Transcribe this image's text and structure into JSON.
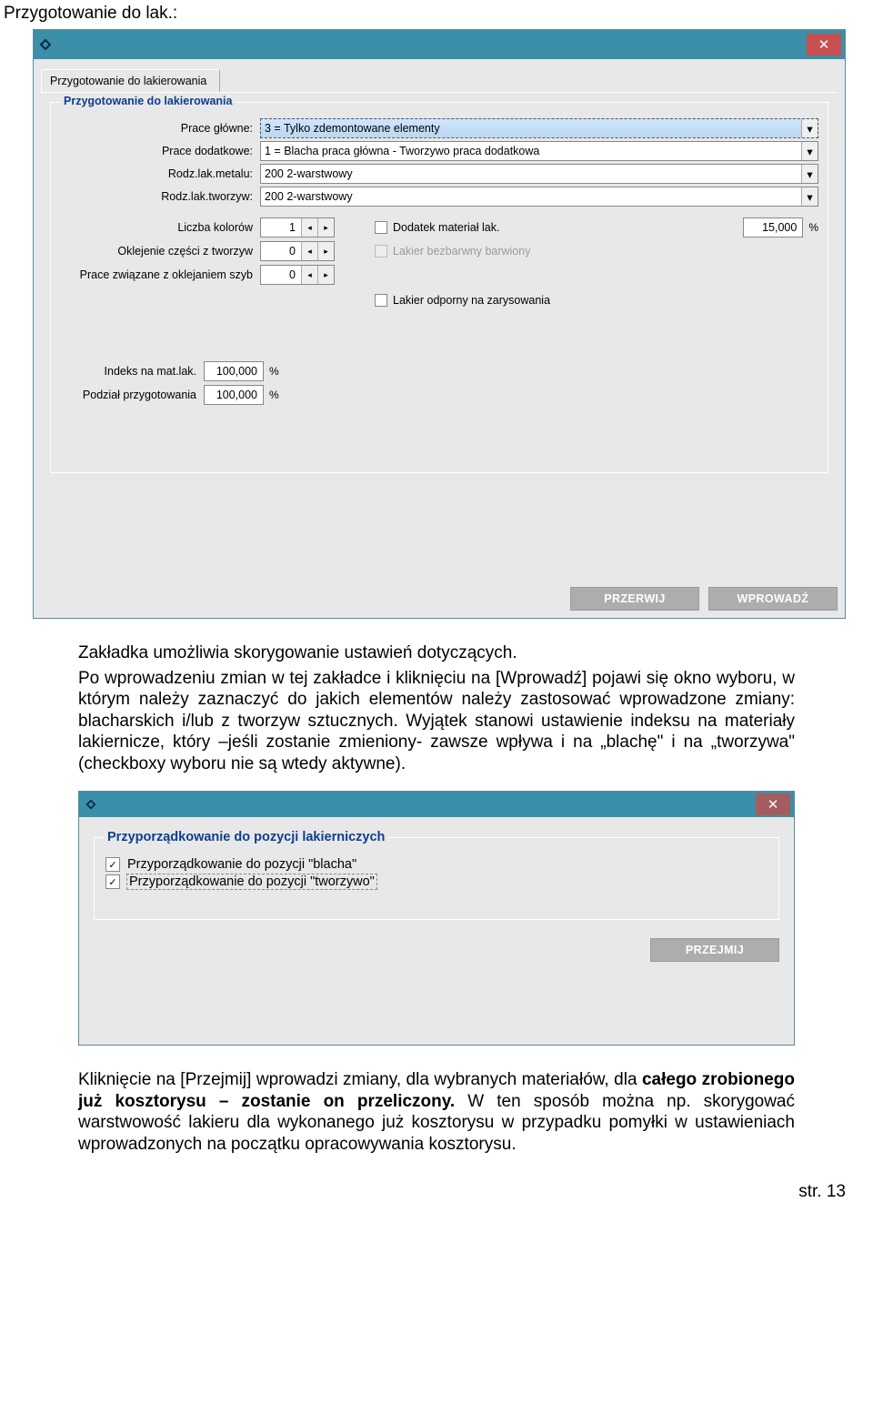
{
  "doc": {
    "title": "Przygotowanie do lak.:",
    "para1": "Zakładka umożliwia skorygowanie ustawień dotyczących.",
    "para2": "Po wprowadzeniu zmian w tej zakładce i kliknięciu na [Wprowadź] pojawi się okno wyboru, w którym należy zaznaczyć do jakich elementów należy zastosować wprowadzone zmiany: blacharskich i/lub z tworzyw sztucznych. Wyjątek stanowi ustawienie indeksu na materiały lakiernicze, który –jeśli zostanie zmieniony- zawsze wpływa i na „blachę\" i na „tworzywa\" (checkboxy wyboru nie są wtedy aktywne).",
    "para3_a": "Kliknięcie na [Przejmij] wprowadzi zmiany, dla wybranych materiałów, dla ",
    "para3_b_bold": "całego zrobionego już kosztorysu – zostanie on przeliczony.",
    "para3_c": " W ten sposób można np. skorygować warstwowość lakieru dla wykonanego już kosztorysu w przypadku pomyłki w ustawieniach wprowadzonych na początku opracowywania kosztorysu.",
    "footer": "str. 13"
  },
  "win1": {
    "tab": "Przygotowanie do lakierowania",
    "fs_title": "Przygotowanie do lakierowania",
    "labels": {
      "prace_glowne": "Prace główne:",
      "prace_dodatkowe": "Prace dodatkowe:",
      "rodz_metal": "Rodz.lak.metalu:",
      "rodz_tworzyw": "Rodz.lak.tworzyw:",
      "liczba_kolorow": "Liczba kolorów",
      "oklejenie": "Oklejenie części z tworzyw",
      "prace_szyb": "Prace związane z oklejaniem szyb",
      "dodatek": "Dodatek materiał lak.",
      "lakier_bezb": "Lakier bezbarwny barwiony",
      "lakier_zarys": "Lakier odporny na zarysowania",
      "indeks": "Indeks na mat.lak.",
      "podzial": "Podział przygotowania"
    },
    "values": {
      "prace_glowne": "3 = Tylko zdemontowane elementy",
      "prace_dodatkowe": "1 = Blacha praca główna - Tworzywo praca dodatkowa",
      "rodz_metal": "200  2-warstwowy",
      "rodz_tworzyw": "200  2-warstwowy",
      "liczba_kolorow": "1",
      "oklejenie": "0",
      "prace_szyb": "0",
      "dodatek_pct": "15,000",
      "indeks": "100,000",
      "podzial": "100,000"
    },
    "buttons": {
      "przerwij": "PRZERWIJ",
      "wprowadz": "WPROWADŹ"
    }
  },
  "win2": {
    "fs_title": "Przyporządkowanie do pozycji lakierniczych",
    "opt1": "Przyporządkowanie do pozycji \"blacha\"",
    "opt2": "Przyporządkowanie do pozycji \"tworzywo\"",
    "button": "PRZEJMIJ"
  }
}
